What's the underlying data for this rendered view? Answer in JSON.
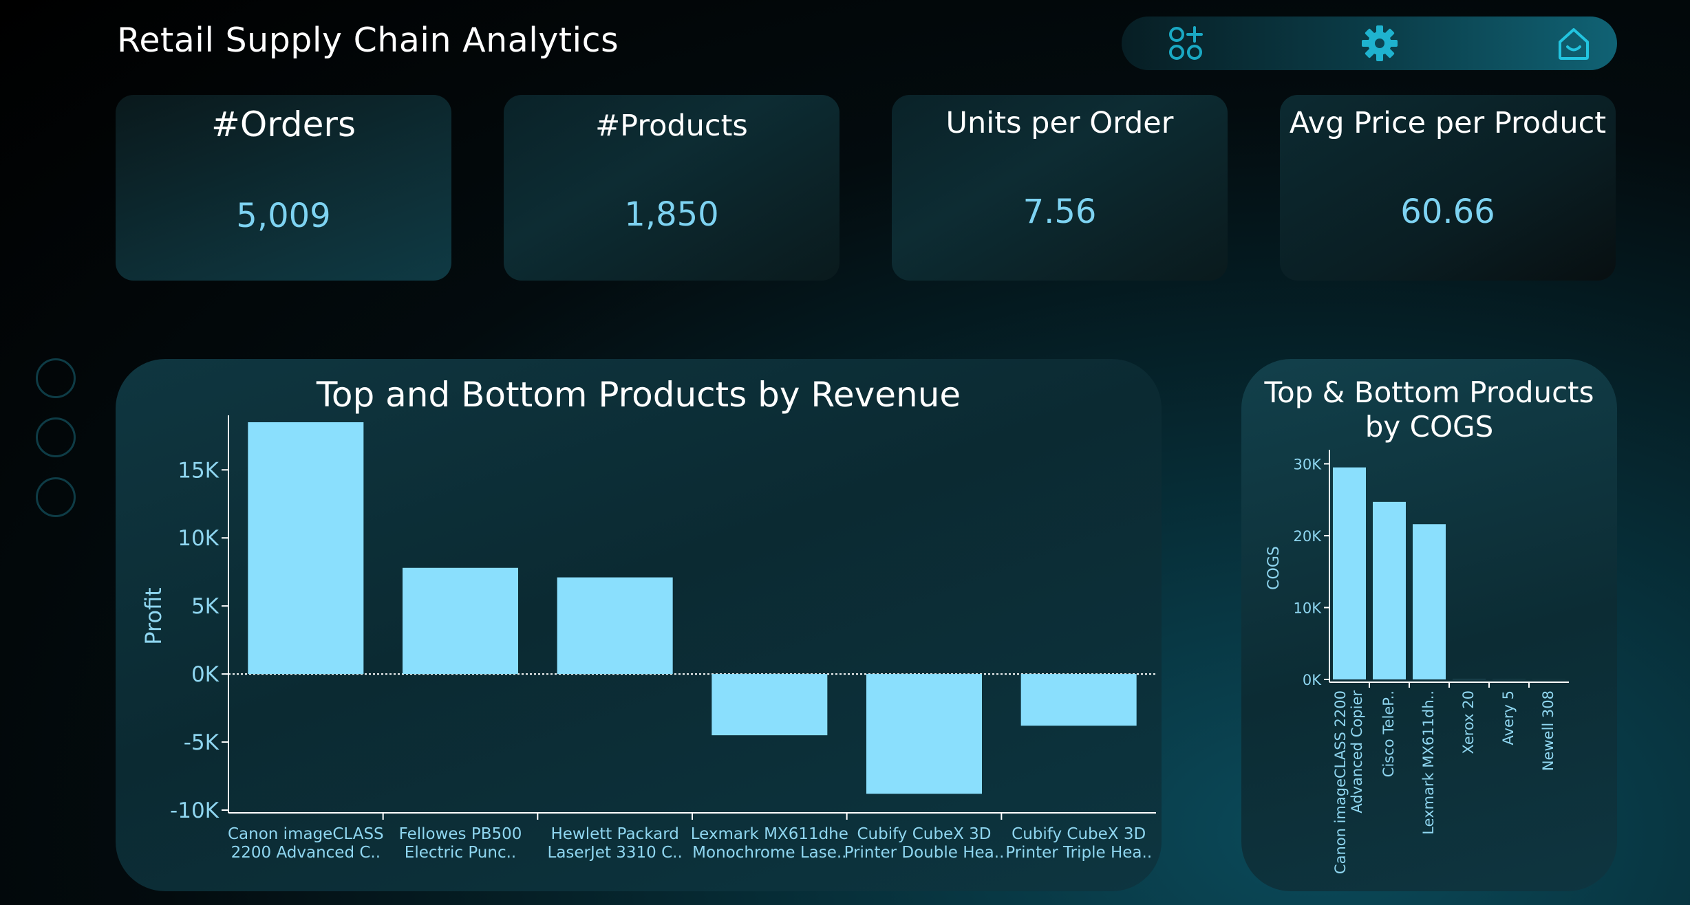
{
  "header": {
    "title": "Retail Supply Chain Analytics"
  },
  "nav": {
    "apps_icon": "apps-add-icon",
    "settings_icon": "gear-icon",
    "home_icon": "home-icon"
  },
  "kpis": [
    {
      "label": "#Orders",
      "value": "5,009"
    },
    {
      "label": "#Products",
      "value": "1,850"
    },
    {
      "label": "Units per Order",
      "value": "7.56"
    },
    {
      "label": "Avg Price per Product",
      "value": "60.66"
    }
  ],
  "colors": {
    "bar": "#8adffd",
    "kpi_value": "#7ed3f2",
    "tick_text": "#8fd6f0",
    "axis_line": "#ffffff",
    "text": "#ffffff"
  },
  "chart_data": [
    {
      "type": "bar",
      "title": "Top and Bottom Products by Revenue",
      "xlabel": "",
      "ylabel": "Profit",
      "ylim": [
        -10000,
        18500
      ],
      "yticks": [
        -10000,
        -5000,
        0,
        5000,
        10000,
        15000
      ],
      "ytick_labels": [
        "-10K",
        "-5K",
        "0K",
        "5K",
        "10K",
        "15K"
      ],
      "grid": false,
      "zero_line": "dotted",
      "categories": [
        [
          "Canon imageCLASS",
          "2200 Advanced C.."
        ],
        [
          "Fellowes PB500",
          "Electric Punc.."
        ],
        [
          "Hewlett Packard",
          "LaserJet 3310 C.."
        ],
        [
          "Lexmark MX611dhe",
          "Monochrome Lase.."
        ],
        [
          "Cubify CubeX 3D",
          "Printer Double Hea.."
        ],
        [
          "Cubify CubeX 3D",
          "Printer Triple Hea.."
        ]
      ],
      "values": [
        18500,
        7800,
        7100,
        -4500,
        -8800,
        -3800
      ]
    },
    {
      "type": "bar",
      "title": "Top & Bottom Products by COGS",
      "xlabel": "",
      "ylabel": "COGS",
      "ylim": [
        0,
        31000
      ],
      "yticks": [
        0,
        10000,
        20000,
        30000
      ],
      "ytick_labels": [
        "0K",
        "10K",
        "20K",
        "30K"
      ],
      "grid": false,
      "categories": [
        [
          "Canon imageCLASS 2200",
          "Advanced Copier"
        ],
        [
          "Cisco TeleP.."
        ],
        [
          "Lexmark MX611dh.."
        ],
        [
          "Xerox 20"
        ],
        [
          "Avery 5"
        ],
        [
          "Newell 308"
        ]
      ],
      "values": [
        29500,
        24700,
        21600,
        20,
        10,
        5
      ]
    }
  ]
}
